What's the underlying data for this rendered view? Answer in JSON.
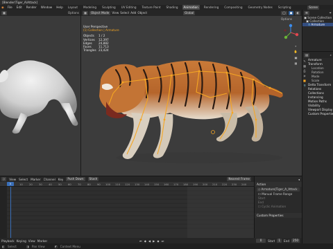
{
  "title": "[Blender\\Tiger_A\\Attack]",
  "menus": [
    "File",
    "Edit",
    "Render",
    "Window",
    "Help"
  ],
  "workspaces": [
    {
      "label": "Layout",
      "active": false
    },
    {
      "label": "Modeling",
      "active": false
    },
    {
      "label": "Sculpting",
      "active": false
    },
    {
      "label": "UV Editing",
      "active": false
    },
    {
      "label": "Texture Paint",
      "active": false
    },
    {
      "label": "Shading",
      "active": false
    },
    {
      "label": "Animation",
      "active": true
    },
    {
      "label": "Rendering",
      "active": false
    },
    {
      "label": "Compositing",
      "active": false
    },
    {
      "label": "Geometry Nodes",
      "active": false
    },
    {
      "label": "Scripting",
      "active": false
    }
  ],
  "scene_label": "Scene",
  "left_viewport": {
    "options": "Options"
  },
  "viewport": {
    "mode": "Object Mode",
    "menus": [
      "View",
      "Select",
      "Add",
      "Object"
    ],
    "transform": "Global",
    "options": "Options",
    "view_name": "User Perspective",
    "collection": "(1) Collection | Armature",
    "stats": [
      {
        "label": "Objects",
        "value": "1 / 2"
      },
      {
        "label": "Vertices",
        "value": "12,397"
      },
      {
        "label": "Edges",
        "value": "24,882"
      },
      {
        "label": "Faces",
        "value": "11,713"
      },
      {
        "label": "Triangles",
        "value": "23,424"
      }
    ]
  },
  "outliner": {
    "rows": [
      {
        "label": "Scene Collection",
        "hl": false
      },
      {
        "label": "Collection",
        "hl": false
      },
      {
        "label": "Armature",
        "hl": true
      }
    ]
  },
  "properties": {
    "object_name": "Armature",
    "rows": [
      {
        "label": "Armature",
        "head": true
      },
      {
        "label": "Transform",
        "head": true
      },
      {
        "label": "Location",
        "head": false
      },
      {
        "label": "Rotation",
        "head": false
      },
      {
        "label": "Mode",
        "head": false
      },
      {
        "label": "Scale",
        "head": false
      },
      {
        "label": "Delta Transform",
        "head": true
      },
      {
        "label": "Relations",
        "head": true
      },
      {
        "label": "Collections",
        "head": true
      },
      {
        "label": "Instancing",
        "head": true
      },
      {
        "label": "Motion Paths",
        "head": true
      },
      {
        "label": "Visibility",
        "head": true
      },
      {
        "label": "Viewport Display",
        "head": true
      },
      {
        "label": "Custom Properties",
        "head": true
      }
    ]
  },
  "dope_sheet": {
    "menus": [
      "View",
      "Select",
      "Marker",
      "Channel",
      "Key"
    ],
    "mode": "Push Down",
    "stash": "Stash",
    "action": "Armature|Tiger_A_Attack",
    "nearest_frame": "Nearest Frame",
    "current_frame": "0",
    "ruler": [
      "0",
      "10",
      "20",
      "30",
      "40",
      "50",
      "60",
      "70",
      "80",
      "90",
      "100",
      "110",
      "120",
      "130",
      "140",
      "150",
      "160",
      "170",
      "180",
      "190",
      "200",
      "210",
      "220",
      "230",
      "240",
      "250"
    ]
  },
  "action_panel": {
    "heading": "Action",
    "action_name": "Armature|Tiger_A_Attack",
    "manual_frame_range": "Manual Frame Range",
    "start": "Start",
    "end": "End",
    "cyclic": "Cyclic Animation",
    "custom_properties": "Custom Properties"
  },
  "playback": {
    "label": "Playback",
    "keying": "Keying",
    "view": "View",
    "marker": "Marker",
    "frame": "0",
    "start_label": "Start",
    "start": "1",
    "end_label": "End",
    "end": "250"
  },
  "status": [
    "Select",
    "Pan View",
    "Context Menu"
  ],
  "colors": {
    "accent": "#f5a623",
    "selection": "#334d80",
    "playhead": "#3a6fb8"
  }
}
